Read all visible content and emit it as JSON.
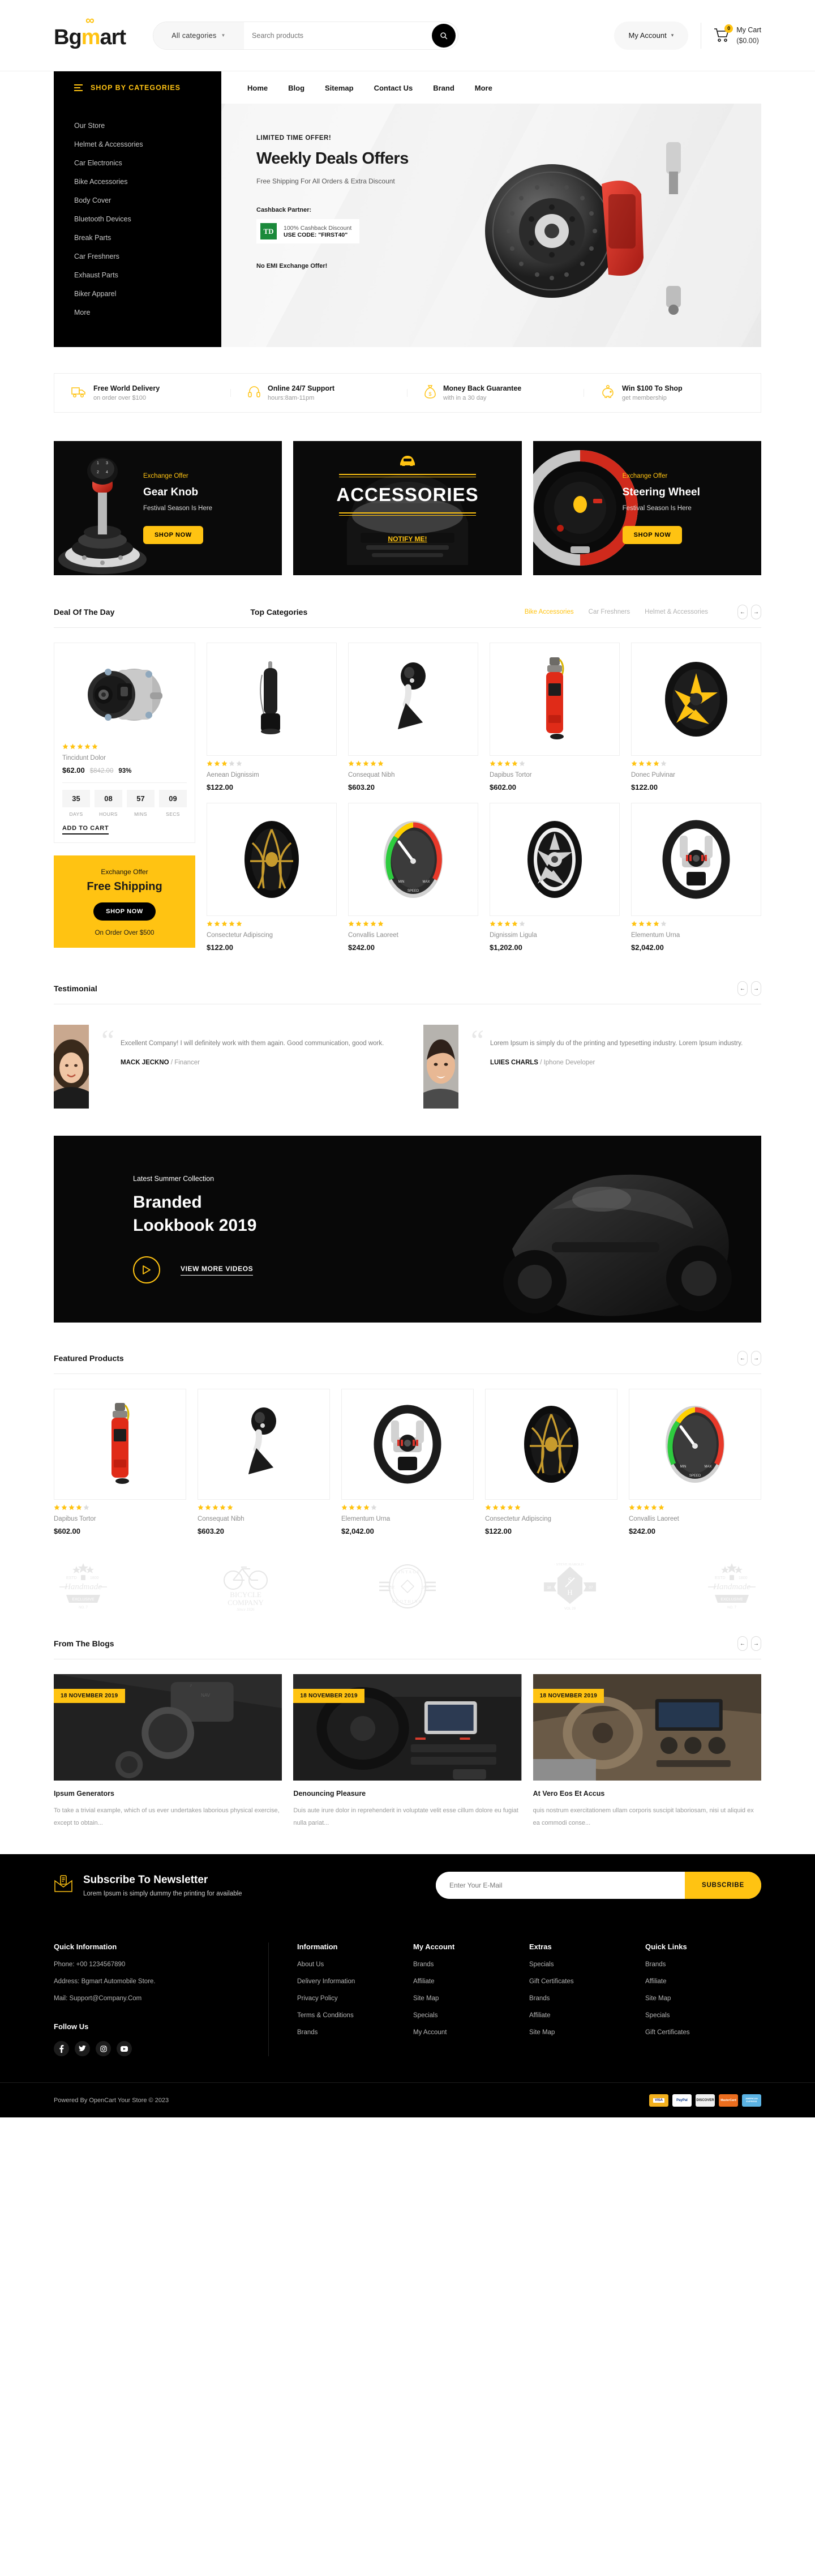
{
  "brand": {
    "name_part1": "Bg",
    "name_part2": "m",
    "name_part3": "art",
    "accent": "#FFC312"
  },
  "header": {
    "category_select": "All categories",
    "search_placeholder": "Search products",
    "search_icon": "search-icon",
    "account_label": "My Account",
    "cart_label": "My Cart",
    "cart_amount": "($0.00)",
    "cart_count": "0"
  },
  "nav": {
    "shop_by_categories": "SHOP BY CATEGORIES",
    "links": [
      "Home",
      "Blog",
      "Sitemap",
      "Contact Us",
      "Brand",
      "More"
    ]
  },
  "categories": [
    "Our Store",
    "Helmet & Accessories",
    "Car Electronics",
    "Bike Accessories",
    "Body Cover",
    "Bluetooth Devices",
    "Break Parts",
    "Car Freshners",
    "Exhaust Parts",
    "Biker Apparel",
    "More"
  ],
  "hero": {
    "kicker": "LIMITED TIME OFFER!",
    "title": "Weekly Deals Offers",
    "subtitle": "Free Shipping For All Orders & Extra Discount",
    "cashback_label": "Cashback Partner:",
    "cashback_logo": "TD",
    "cashback_line1": "100% Cashback Discount",
    "cashback_line2": "USE CODE: \"FIRST40\"",
    "no_emi": "No EMI Exchange Offer!"
  },
  "services": [
    {
      "icon": "truck-icon",
      "title": "Free World Delivery",
      "sub": "on order over $100"
    },
    {
      "icon": "headset-icon",
      "title": "Online 24/7 Support",
      "sub": "hours:8am-11pm"
    },
    {
      "icon": "moneybag-icon",
      "title": "Money Back Guarantee",
      "sub": "with in a 30 day"
    },
    {
      "icon": "piggybank-icon",
      "title": "Win $100 To Shop",
      "sub": "get membership"
    }
  ],
  "promos": [
    {
      "kicker": "Exchange Offer",
      "title": "Gear Knob",
      "sub": "Festival Season Is Here",
      "button": "SHOP NOW"
    },
    {
      "title": "ACCESSORIES",
      "link": "NOTIFY ME!"
    },
    {
      "kicker": "Exchange Offer",
      "title": "Steering Wheel",
      "sub": "Festival Season Is Here",
      "button": "SHOP NOW"
    }
  ],
  "deal_section": {
    "title": "Deal Of The Day",
    "second_title": "Top Categories",
    "tabs": [
      {
        "label": "Bike Accessories",
        "active": true
      },
      {
        "label": "Car Freshners",
        "active": false
      },
      {
        "label": "Helmet & Accessories",
        "active": false
      }
    ]
  },
  "deal_product": {
    "image": "alternator-image",
    "rating": 5,
    "name": "Tincidunt Dolor",
    "price": "$62.00",
    "old_price": "$842.00",
    "discount": "93%",
    "countdown": [
      {
        "value": "35",
        "label": "DAYS"
      },
      {
        "value": "08",
        "label": "HOURS"
      },
      {
        "value": "57",
        "label": "MINS"
      },
      {
        "value": "09",
        "label": "SECS"
      }
    ],
    "add_to_cart": "ADD TO CART"
  },
  "free_shipping": {
    "kicker": "Exchange Offer",
    "title": "Free Shipping",
    "button": "SHOP NOW",
    "note": "On Order Over $500"
  },
  "grid_products": [
    {
      "image": "car-charger-image",
      "rating": 3,
      "name": "Aenean Dignissim",
      "price": "$122.00"
    },
    {
      "image": "gear-knob-image",
      "rating": 5,
      "name": "Consequat Nibh",
      "price": "$603.20"
    },
    {
      "image": "fire-extinguisher-image",
      "rating": 4,
      "name": "Dapibus Tortor",
      "price": "$602.00"
    },
    {
      "image": "yellow-wheel-image",
      "rating": 4,
      "name": "Donec Pulvinar",
      "price": "$122.00"
    },
    {
      "image": "gold-wheel-image",
      "rating": 5,
      "name": "Consectetur Adipiscing",
      "price": "$122.00"
    },
    {
      "image": "speedometer-image",
      "rating": 5,
      "name": "Convallis Laoreet",
      "price": "$242.00"
    },
    {
      "image": "silver-wheel-image",
      "rating": 4,
      "name": "Dignissim Ligula",
      "price": "$1,202.00"
    },
    {
      "image": "steering-wheel-image",
      "rating": 4,
      "name": "Elementum Urna",
      "price": "$2,042.00"
    }
  ],
  "testimonial_section": {
    "title": "Testimonial"
  },
  "testimonials": [
    {
      "avatar": "woman-portrait",
      "text": "Excellent Company! I will definitely work with them again. Good communication, good work.",
      "name": "MACK JECKNO",
      "role": "Financer"
    },
    {
      "avatar": "man-portrait",
      "text": "Lorem Ipsum is simply du of the printing and typesetting industry. Lorem Ipsum industry.",
      "name": "LUIES CHARLS",
      "role": "Iphone Developer"
    }
  ],
  "lookbook": {
    "kicker": "Latest Summer Collection",
    "title_line1": "Branded",
    "title_line2": "Lookbook 2019",
    "link": "VIEW MORE VIDEOS",
    "play_icon": "play-icon"
  },
  "featured_section": {
    "title": "Featured Products"
  },
  "featured_products": [
    {
      "image": "fire-extinguisher-image",
      "rating": 4,
      "name": "Dapibus Tortor",
      "price": "$602.00"
    },
    {
      "image": "gear-knob-image",
      "rating": 5,
      "name": "Consequat Nibh",
      "price": "$603.20"
    },
    {
      "image": "steering-wheel-image",
      "rating": 4,
      "name": "Elementum Urna",
      "price": "$2,042.00"
    },
    {
      "image": "gold-wheel-image",
      "rating": 5,
      "name": "Consectetur Adipiscing",
      "price": "$122.00"
    },
    {
      "image": "speedometer-image",
      "rating": 5,
      "name": "Convallis Laoreet",
      "price": "$242.00"
    }
  ],
  "brands": [
    {
      "name": "Handmade Exclusive No.7",
      "l1": "ESTD 1800",
      "l2": "Handmade",
      "l3": "EXCLUSIVE",
      "l4": "NO. 7"
    },
    {
      "name": "Bicycle Company",
      "l1": "BICYCLE",
      "l2": "COMPANY",
      "l3": "Since 1926"
    },
    {
      "name": "Vintage Clothing",
      "l1": "VINTAGE",
      "l2": "EST. 1984",
      "l3": "CLOTHING"
    },
    {
      "name": "Steve Harold",
      "l1": "STEVE HAROLD",
      "l2": "S H",
      "l3": "18 07",
      "l4": "VOL 29"
    },
    {
      "name": "Handmade Exclusive No.7",
      "l1": "ESTD 1800",
      "l2": "Handmade",
      "l3": "EXCLUSIVE",
      "l4": "NO. 7"
    }
  ],
  "blog_section": {
    "title": "From The Blogs"
  },
  "blogs": [
    {
      "image": "car-console-image",
      "date": "18 NOVEMBER 2019",
      "title": "Ipsum Generators",
      "text": "To take a trivial example, which of us ever undertakes laborious physical exercise, except to obtain..."
    },
    {
      "image": "bmw-interior-image",
      "date": "18 NOVEMBER 2019",
      "title": "Denouncing Pleasure",
      "text": "Duis aute irure dolor in reprehenderit in voluptate velit esse cillum dolore eu fugiat nulla pariat..."
    },
    {
      "image": "mercedes-interior-image",
      "date": "18 NOVEMBER 2019",
      "title": "At Vero Eos Et Accus",
      "text": "quis nostrum exercitationem ullam corporis suscipit laboriosam, nisi ut aliquid ex ea commodi conse..."
    }
  ],
  "newsletter": {
    "icon": "envelope-icon",
    "title": "Subscribe To Newsletter",
    "subtitle": "Lorem Ipsum is simply dummy the printing for available",
    "placeholder": "Enter Your E-Mail",
    "button": "SUBSCRIBE"
  },
  "footer": {
    "quick_information_title": "Quick Information",
    "phone": "Phone:  +00 1234567890",
    "address": "Address:  Bgmart Automobile Store.",
    "mail": "Mail:  Support@Company.Com",
    "follow_title": "Follow Us",
    "socials": [
      "facebook-icon",
      "twitter-icon",
      "instagram-icon",
      "youtube-icon"
    ],
    "columns": [
      {
        "title": "Information",
        "links": [
          "About Us",
          "Delivery Information",
          "Privacy Policy",
          "Terms & Conditions",
          "Brands"
        ]
      },
      {
        "title": "My Account",
        "links": [
          "Brands",
          "Affiliate",
          "Site Map",
          "Specials",
          "My Account"
        ]
      },
      {
        "title": "Extras",
        "links": [
          "Specials",
          "Gift Certificates",
          "Brands",
          "Affiliate",
          "Site Map"
        ]
      },
      {
        "title": "Quick Links",
        "links": [
          "Brands",
          "Affiliate",
          "Site Map",
          "Specials",
          "Gift Certificates"
        ]
      }
    ],
    "copyright": "Powered By OpenCart Your Store © 2023",
    "payments": [
      "VISA",
      "PayPal",
      "DISCOVER",
      "MasterCard",
      "AMERICAN EXPRESS"
    ]
  }
}
